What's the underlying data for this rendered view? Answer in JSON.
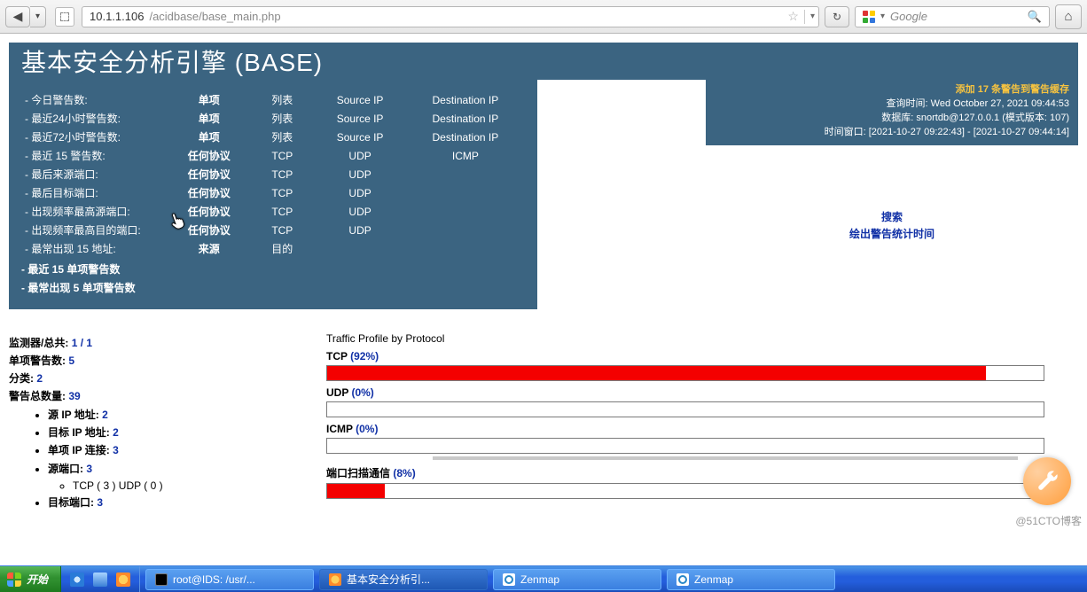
{
  "browser": {
    "url_host": "10.1.1.106",
    "url_path": "/acidbase/base_main.php",
    "search_placeholder": "Google"
  },
  "header": {
    "title": "基本安全分析引擎 (BASE)"
  },
  "right_info": {
    "alerts_added": "添加 17 条警告到警告缓存",
    "queried_on": "查询时间: Wed October 27, 2021 09:44:53",
    "database": "数据库: snortdb@127.0.0.1    (模式版本: 107)",
    "time_window": "时间窗口: [2021-10-27 09:22:43] - [2021-10-27 09:44:14]"
  },
  "right_center": {
    "l1": "搜索",
    "l2": "绘出警告统计时间"
  },
  "left_rows": [
    {
      "c1": "- 今日警告数:",
      "c2": "单项",
      "c3": "列表",
      "c4": "Source IP",
      "c5": "Destination IP"
    },
    {
      "c1": "- 最近24小时警告数:",
      "c2": "单项",
      "c3": "列表",
      "c4": "Source IP",
      "c5": "Destination IP"
    },
    {
      "c1": "- 最近72小时警告数:",
      "c2": "单项",
      "c3": "列表",
      "c4": "Source IP",
      "c5": "Destination IP"
    },
    {
      "c1": "- 最近 15 警告数:",
      "c2": "任何协议",
      "c3": "TCP",
      "c4": "UDP",
      "c5": "ICMP"
    },
    {
      "c1": "- 最后来源端口:",
      "c2": "任何协议",
      "c3": "TCP",
      "c4": "UDP",
      "c5": ""
    },
    {
      "c1": "- 最后目标端口:",
      "c2": "任何协议",
      "c3": "TCP",
      "c4": "UDP",
      "c5": ""
    },
    {
      "c1": "- 出现频率最高源端口:",
      "c2": "任何协议",
      "c3": "TCP",
      "c4": "UDP",
      "c5": ""
    },
    {
      "c1": "- 出现频率最高目的端口:",
      "c2": "任何协议",
      "c3": "TCP",
      "c4": "UDP",
      "c5": ""
    },
    {
      "c1": "- 最常出现 15 地址:",
      "c2": "来源",
      "c3": "目的",
      "c4": "",
      "c5": ""
    }
  ],
  "left_extra": [
    "- 最近 15 单项警告数",
    "- 最常出现 5 单项警告数"
  ],
  "stats": {
    "sensors_label": "监测器/总共:",
    "sensors_val": "1 / 1",
    "unique_alerts_label": "单项警告数:",
    "unique_alerts_val": "5",
    "categories_label": "分类:",
    "categories_val": "2",
    "total_alerts_label": "警告总数量:",
    "total_alerts_val": "39",
    "src_ip_label": "源 IP 地址:",
    "src_ip_val": "2",
    "dst_ip_label": "目标 IP 地址:",
    "dst_ip_val": "2",
    "unique_ip_label": "单项 IP 连接:",
    "unique_ip_val": "3",
    "src_port_label": "源端口:",
    "src_port_val": "3",
    "tcp_count": "TCP ( 3 )",
    "udp_count": "UDP ( 0 )",
    "dst_port_label": "目标端口:",
    "dst_port_val": "3"
  },
  "traffic": {
    "title": "Traffic Profile by Protocol",
    "tcp_label": "TCP",
    "tcp_pct": "(92%)",
    "udp_label": "UDP",
    "udp_pct": "(0%)",
    "icmp_label": "ICMP",
    "icmp_pct": "(0%)",
    "port_label": "端口扫描通信",
    "port_pct": "(8%)"
  },
  "chart_data": {
    "type": "bar",
    "title": "Traffic Profile by Protocol",
    "categories": [
      "TCP",
      "UDP",
      "ICMP",
      "端口扫描通信"
    ],
    "values": [
      92,
      0,
      0,
      8
    ],
    "xlabel": "",
    "ylabel": "percent",
    "ylim": [
      0,
      100
    ]
  },
  "watermark": "@51CTO博客",
  "taskbar": {
    "start": "开始",
    "items": [
      {
        "icon": "term",
        "label": "root@IDS: /usr/..."
      },
      {
        "icon": "ff",
        "label": "基本安全分析引..."
      },
      {
        "icon": "zen",
        "label": "Zenmap"
      },
      {
        "icon": "zen",
        "label": "Zenmap"
      }
    ]
  }
}
